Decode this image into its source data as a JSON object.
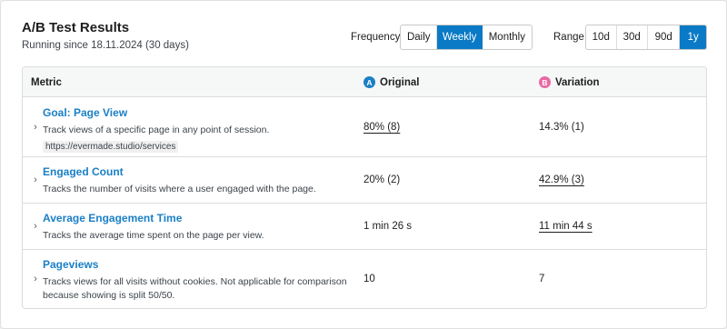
{
  "header": {
    "title": "A/B Test Results",
    "subtitle": "Running since 18.11.2024 (30 days)"
  },
  "frequency": {
    "label": "Frequency",
    "options": [
      "Daily",
      "Weekly",
      "Monthly"
    ],
    "selected": "Weekly"
  },
  "range": {
    "label": "Range",
    "options": [
      "10d",
      "30d",
      "90d",
      "1y"
    ],
    "selected": "1y"
  },
  "table": {
    "columns": {
      "metric": "Metric",
      "original": "Original",
      "original_badge": "A",
      "variation": "Variation",
      "variation_badge": "B"
    },
    "rows": [
      {
        "title": "Goal: Page View",
        "description": "Track views of a specific page in any point of session.",
        "url": "https://evermade.studio/services",
        "original": "80% (8)",
        "variation": "14.3% (1)",
        "winner": "original"
      },
      {
        "title": "Engaged Count",
        "description": "Tracks the number of visits where a user engaged with the page.",
        "original": "20% (2)",
        "variation": "42.9% (3)",
        "winner": "variation"
      },
      {
        "title": "Average Engagement Time",
        "description": "Tracks the average time spent on the page per view.",
        "original": "1 min 26 s",
        "variation": "11 min 44 s",
        "winner": "variation"
      },
      {
        "title": "Pageviews",
        "description": "Tracks views for all visits without cookies. Not applicable for comparison because showing is split 50/50.",
        "original": "10",
        "variation": "7",
        "winner": "none"
      }
    ]
  },
  "colors": {
    "accent": "#0a7ac6",
    "link": "#1a7fc6",
    "badge_a": "#1a7fc6",
    "badge_b": "#e86aa4"
  },
  "icons": {
    "row_toggle": "chevron-right-icon"
  }
}
